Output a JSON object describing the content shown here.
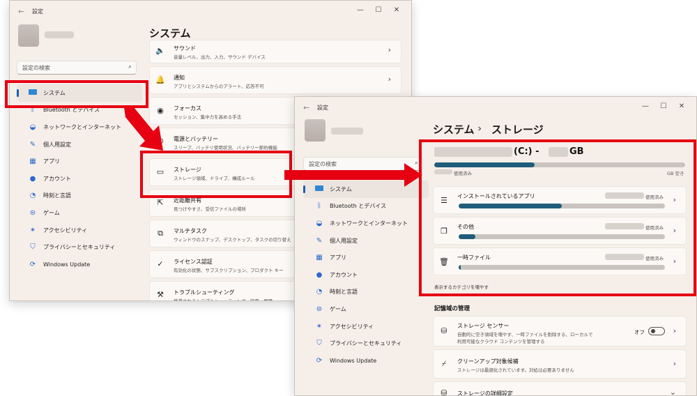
{
  "window1": {
    "title": "設定",
    "search_placeholder": "設定の検索",
    "page_title": "システム",
    "nav": [
      {
        "label": "システム",
        "icon": "display-icon"
      },
      {
        "label": "Bluetooth とデバイス",
        "icon": "bluetooth-icon"
      },
      {
        "label": "ネットワークとインターネット",
        "icon": "wifi-icon"
      },
      {
        "label": "個人用設定",
        "icon": "brush-icon"
      },
      {
        "label": "アプリ",
        "icon": "apps-icon"
      },
      {
        "label": "アカウント",
        "icon": "account-icon"
      },
      {
        "label": "時刻と言語",
        "icon": "globe-clock-icon"
      },
      {
        "label": "ゲーム",
        "icon": "gamepad-icon"
      },
      {
        "label": "アクセシビリティ",
        "icon": "accessibility-icon"
      },
      {
        "label": "プライバシーとセキュリティ",
        "icon": "shield-icon"
      },
      {
        "label": "Windows Update",
        "icon": "update-icon"
      }
    ],
    "cards": [
      {
        "title": "サウンド",
        "sub": "音量レベル、出力、入力、サウンド デバイス",
        "icon": "speaker-icon"
      },
      {
        "title": "通知",
        "sub": "アプリとシステムからのアラート、応答不可",
        "icon": "bell-icon"
      },
      {
        "title": "フォーカス",
        "sub": "セッション、集中力を高める手法",
        "icon": "focus-icon"
      },
      {
        "title": "電源とバッテリー",
        "sub": "スリープ、バッテリ使用状況、バッテリー節約機能",
        "icon": "power-icon"
      },
      {
        "title": "ストレージ",
        "sub": "ストレージ領域、ドライブ、構成ルール",
        "icon": "storage-icon"
      },
      {
        "title": "近距離共有",
        "sub": "見つけやすさ、受信ファイルの場所",
        "icon": "share-icon"
      },
      {
        "title": "マルチタスク",
        "sub": "ウィンドウのスナップ、デスクトップ、タスクの切り替え",
        "icon": "multitask-icon"
      },
      {
        "title": "ライセンス認証",
        "sub": "有効化の状態、サブスクリプション、プロダクト キー",
        "icon": "check-circle-icon"
      },
      {
        "title": "トラブルシューティング",
        "sub": "推奨されるトラブルシューティング、設定、履歴",
        "icon": "wrench-icon"
      }
    ]
  },
  "window2": {
    "title": "設定",
    "search_placeholder": "設定の検索",
    "breadcrumb_parent": "システム",
    "breadcrumb_sep": "›",
    "breadcrumb_current": "ストレージ",
    "drive_label": "(C:) -",
    "drive_unit": "GB",
    "drive_used_label": "使用済み",
    "drive_free_label": "GB 空き",
    "drive_used_fraction": 0.4,
    "categories": [
      {
        "title": "インストールされているアプリ",
        "used": "使用済み",
        "fill": 0.5,
        "icon": "list-icon"
      },
      {
        "title": "その他",
        "used": "使用済み",
        "fill": 0.08,
        "icon": "copy-icon"
      },
      {
        "title": "一時ファイル",
        "used": "使用済み",
        "fill": 0.01,
        "icon": "trash-icon"
      }
    ],
    "show_more": "表示するカテゴリを増やす",
    "mgmt_heading": "記憶域の管理",
    "sense_title": "ストレージ センサー",
    "sense_sub1": "自動的に空き領域を増やす、一時ファイルを削除する、ローカルで",
    "sense_sub2": "利用可能なクラウド コンテンツを管理する",
    "sense_state": "オフ",
    "cleanup_title": "クリーンアップ対象候補",
    "cleanup_sub": "ストレージは最適化されています。対処は必要ありません",
    "advanced_title": "ストレージの詳細設定"
  },
  "colors": {
    "highlight": "#e60012",
    "accent": "#1a5fb4",
    "bar_fill": "#1f5d7a"
  }
}
